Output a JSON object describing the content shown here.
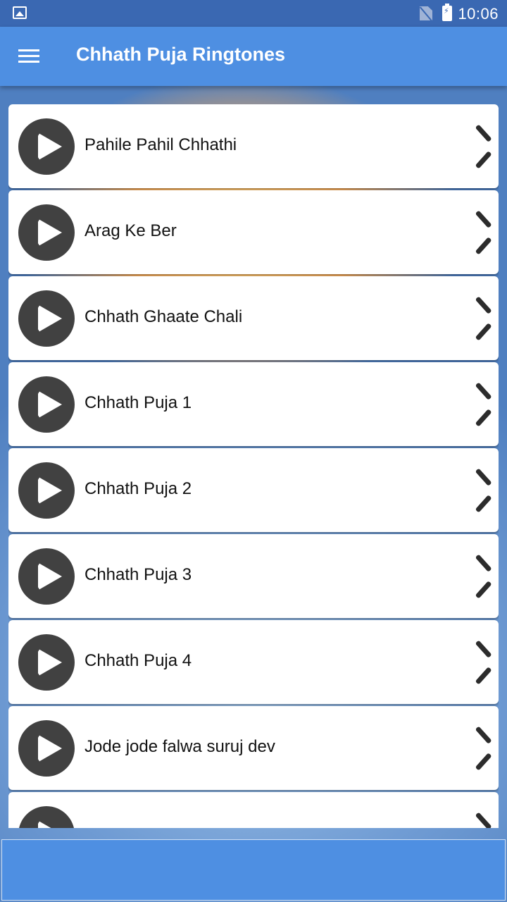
{
  "status_bar": {
    "time": "10:06",
    "icons": [
      "image-icon",
      "no-sim-icon",
      "battery-charging-icon"
    ]
  },
  "app_bar": {
    "title": "Chhath Puja Ringtones",
    "menu_icon": "hamburger-menu-icon"
  },
  "ringtones": [
    {
      "label": "Pahile Pahil Chhathi"
    },
    {
      "label": "Arag Ke Ber"
    },
    {
      "label": "Chhath Ghaate Chali"
    },
    {
      "label": "Chhath Puja 1"
    },
    {
      "label": "Chhath Puja 2"
    },
    {
      "label": "Chhath Puja 3"
    },
    {
      "label": "Chhath Puja 4"
    },
    {
      "label": "Jode jode falwa suruj dev"
    },
    {
      "label": ""
    }
  ],
  "colors": {
    "status_bar": "#3a68b2",
    "app_bar": "#4e8fe2",
    "play_button": "#414141"
  }
}
